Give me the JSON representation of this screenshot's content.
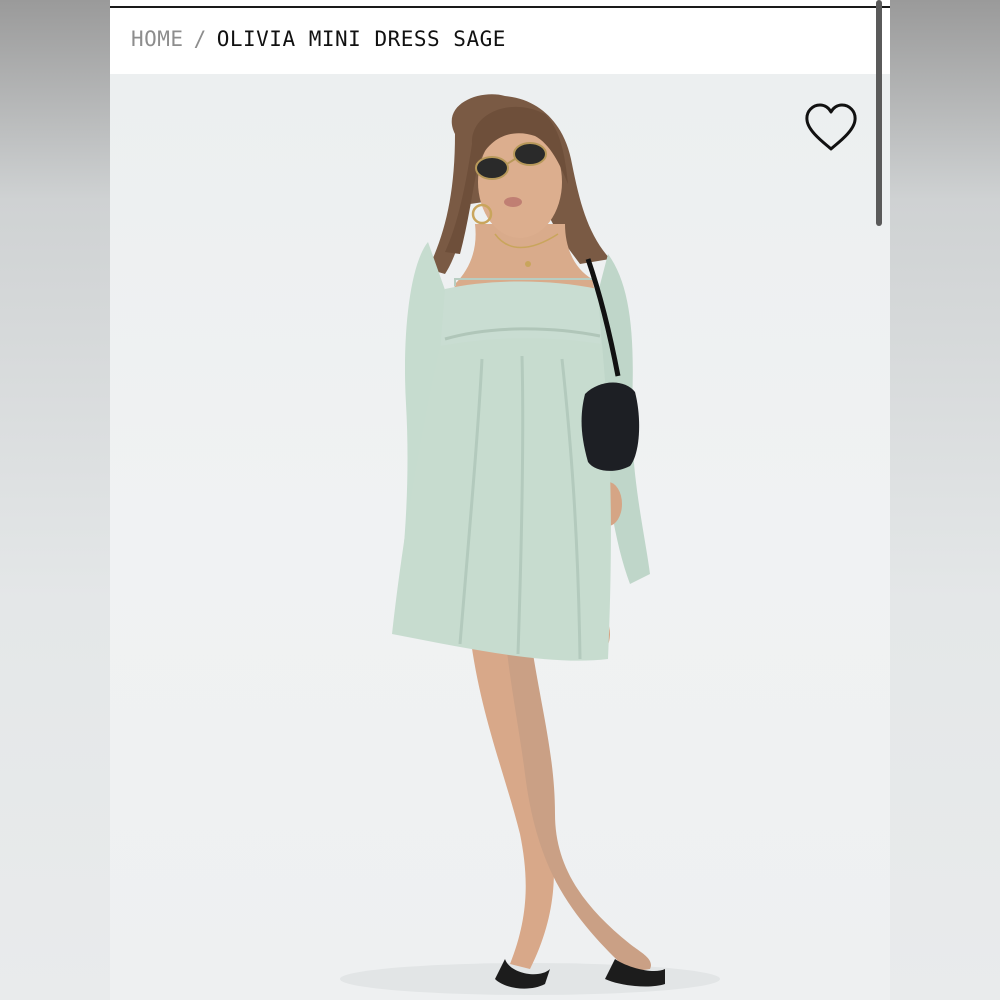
{
  "breadcrumb": {
    "home": "HOME",
    "separator": "/",
    "current": "OLIVIA MINI DRESS SAGE"
  },
  "product": {
    "image_alt": "Model wearing sage long-sleeve babydoll mini dress with black shoulder bag",
    "wishlist_icon": "heart-outline-icon"
  },
  "colors": {
    "dress": "#c9ddd2",
    "background": "#eef0f1",
    "text_primary": "#111111",
    "text_muted": "#8d8d8d"
  }
}
